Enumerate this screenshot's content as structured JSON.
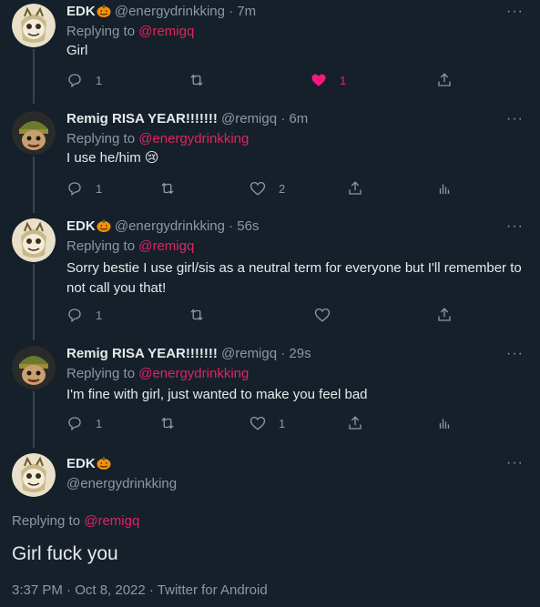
{
  "colors": {
    "background": "#15202b",
    "mention": "#e0245e",
    "like_active": "#f91880",
    "secondary": "#8b98a5"
  },
  "tweets": [
    {
      "name": "EDK",
      "handle": "@energydrinkking",
      "time": "· 7m",
      "reply_prefix": "Replying to",
      "reply_to": "@remigq",
      "text": "Girl",
      "replies": "1",
      "retweets": "",
      "likes": "1",
      "liked": true
    },
    {
      "name": "Remig RISA YEAR!!!!!!!",
      "handle": "@remigq",
      "time": "· 6m",
      "reply_prefix": "Replying to",
      "reply_to": "@energydrinkking",
      "text": "I use he/him",
      "emoji": "😢",
      "replies": "1",
      "retweets": "",
      "likes": "2",
      "liked": false
    },
    {
      "name": "EDK",
      "handle": "@energydrinkking",
      "time": "· 56s",
      "reply_prefix": "Replying to",
      "reply_to": "@remigq",
      "text": "Sorry bestie I use girl/sis as a neutral term for everyone but I'll remember to not call you that!",
      "replies": "1",
      "retweets": "",
      "likes": "",
      "liked": false
    },
    {
      "name": "Remig RISA YEAR!!!!!!!",
      "handle": "@remigq",
      "time": "· 29s",
      "reply_prefix": "Replying to",
      "reply_to": "@energydrinkking",
      "text": "I'm fine with girl, just wanted to make you feel bad",
      "replies": "1",
      "retweets": "",
      "likes": "1",
      "liked": false
    }
  ],
  "main_tweet": {
    "name": "EDK",
    "handle": "@energydrinkking",
    "reply_prefix": "Replying to",
    "reply_to": "@remigq",
    "text": "Girl fuck you",
    "meta": "3:37 PM · Oct 8, 2022 · Twitter for Android"
  },
  "more_label": "···"
}
